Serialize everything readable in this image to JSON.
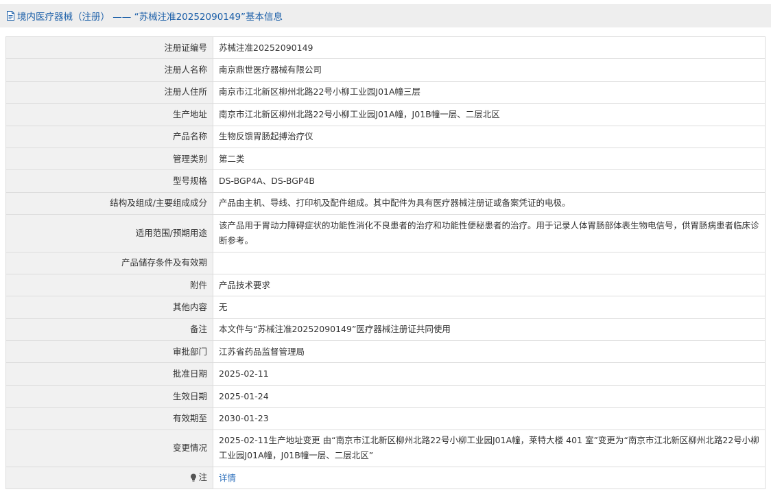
{
  "header": {
    "title": "境内医疗器械（注册） —— “苏械注准20252090149”基本信息",
    "icon": "document-icon"
  },
  "rows": [
    {
      "label": "注册证编号",
      "value": "苏械注准20252090149"
    },
    {
      "label": "注册人名称",
      "value": "南京鼎世医疗器械有限公司"
    },
    {
      "label": "注册人住所",
      "value": "南京市江北新区柳州北路22号小柳工业园J01A幢三层"
    },
    {
      "label": "生产地址",
      "value": "南京市江北新区柳州北路22号小柳工业园J01A幢，J01B幢一层、二层北区"
    },
    {
      "label": "产品名称",
      "value": "生物反馈胃肠起搏治疗仪"
    },
    {
      "label": "管理类别",
      "value": "第二类"
    },
    {
      "label": "型号规格",
      "value": "DS-BGP4A、DS-BGP4B"
    },
    {
      "label": "结构及组成/主要组成成分",
      "value": "产品由主机、导线、打印机及配件组成。其中配件为具有医疗器械注册证或备案凭证的电极。"
    },
    {
      "label": "适用范围/预期用途",
      "value": "该产品用于胃动力障碍症状的功能性消化不良患者的治疗和功能性便秘患者的治疗。用于记录人体胃肠部体表生物电信号，供胃肠病患者临床诊断参考。"
    },
    {
      "label": "产品储存条件及有效期",
      "value": ""
    },
    {
      "label": "附件",
      "value": "产品技术要求"
    },
    {
      "label": "其他内容",
      "value": "无"
    },
    {
      "label": "备注",
      "value": "本文件与“苏械注准20252090149”医疗器械注册证共同使用"
    },
    {
      "label": "审批部门",
      "value": "江苏省药品监督管理局"
    },
    {
      "label": "批准日期",
      "value": "2025-02-11"
    },
    {
      "label": "生效日期",
      "value": "2025-01-24"
    },
    {
      "label": "有效期至",
      "value": "2030-01-23"
    },
    {
      "label": "变更情况",
      "value": "2025-02-11生产地址变更 由“南京市江北新区柳州北路22号小柳工业园J01A幢，莱特大楼 401 室”变更为“南京市江北新区柳州北路22号小柳工业园J01A幢，J01B幢一层、二层北区”"
    }
  ],
  "note": {
    "label": "注",
    "icon": "lightbulb-icon",
    "link_text": "详情"
  },
  "colors": {
    "title_text": "#1a5ea8",
    "title_bg": "#eeeeee",
    "label_bg": "#f1f1f1",
    "border": "#dcdcdc",
    "link": "#2a6ebb"
  }
}
